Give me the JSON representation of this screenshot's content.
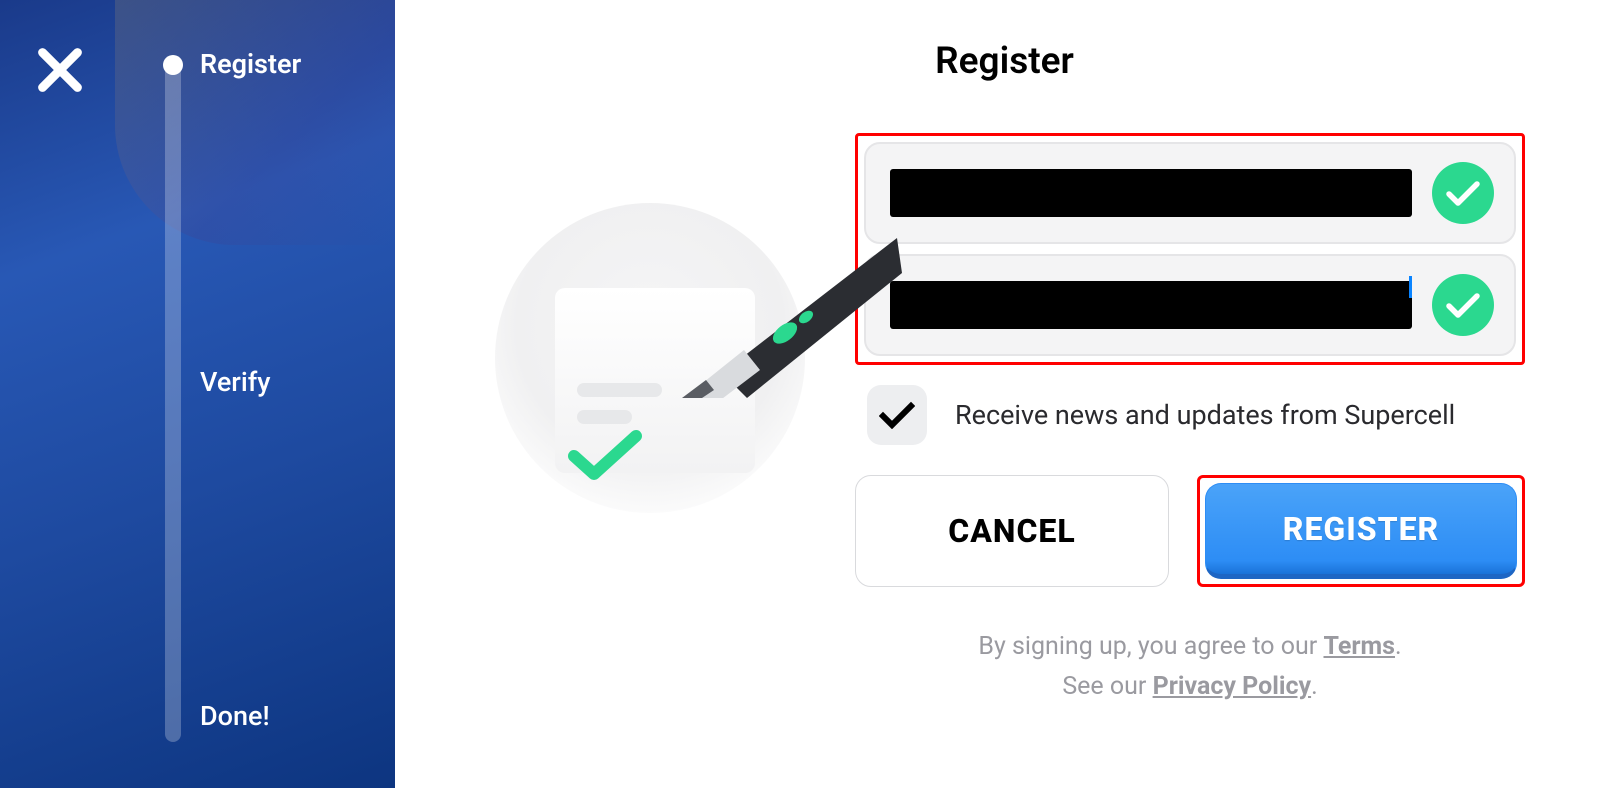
{
  "sidebar": {
    "steps": {
      "register": "Register",
      "verify": "Verify",
      "done": "Done!"
    }
  },
  "main": {
    "title": "Register",
    "checkbox_label": "Receive news and updates from Supercell",
    "buttons": {
      "cancel": "CANCEL",
      "register": "REGISTER"
    },
    "legal": {
      "line1_prefix": "By signing up, you agree to our ",
      "terms": "Terms",
      "line1_suffix": ".",
      "line2_prefix": "See our ",
      "privacy": "Privacy Policy",
      "line2_suffix": "."
    }
  },
  "colors": {
    "accent_green": "#2bd88f",
    "accent_blue": "#2d8df5",
    "highlight_red": "#ff0000"
  }
}
